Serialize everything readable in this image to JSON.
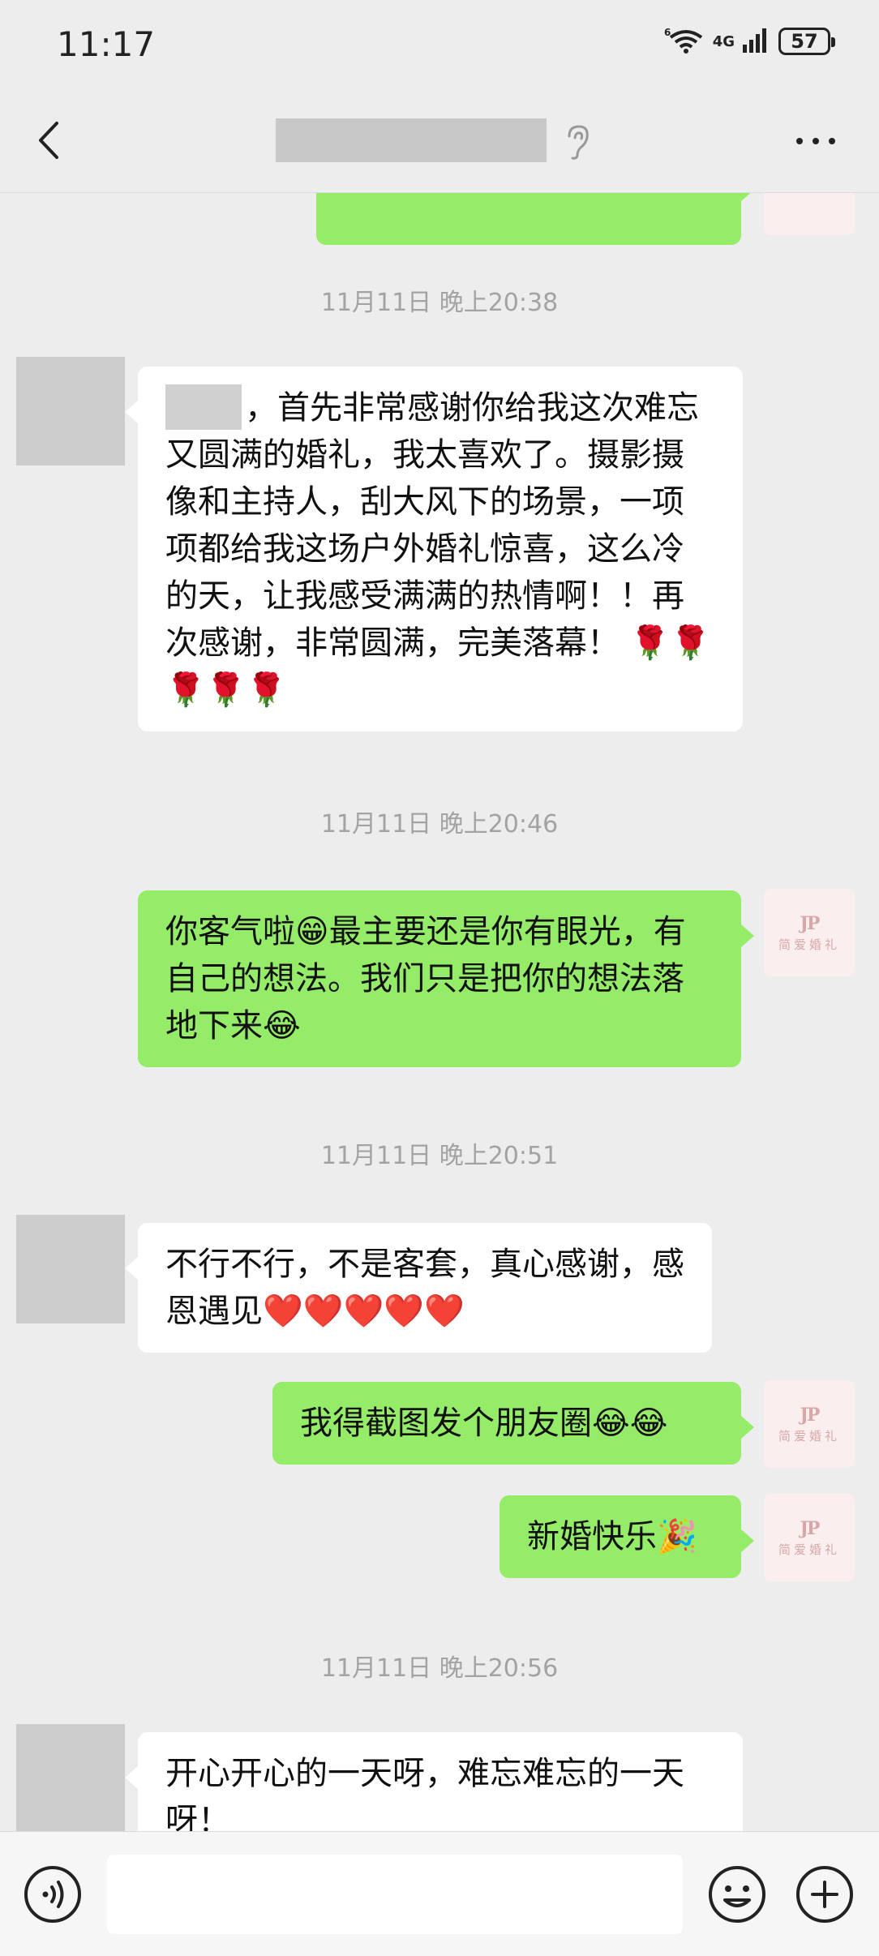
{
  "status_bar": {
    "time": "11:17",
    "wifi_badge": "6",
    "network": "4G",
    "battery": "57"
  },
  "header": {
    "contact_name": "",
    "icons": [
      "back-icon",
      "ear-icon",
      "more-icon"
    ]
  },
  "messages": [
    {
      "type": "timestamp",
      "text": "11月11日 晚上20:38"
    },
    {
      "type": "incoming",
      "text": "，首先非常感谢你给我这次难忘又圆满的婚礼，我太喜欢了。摄影摄像和主持人，刮大风下的场景，一项项都给我这场户外婚礼惊喜，这么冷的天，让我感受满满的热情啊！！再次感谢，非常圆满，完美落幕！ 🌹🌹🌹🌹🌹"
    },
    {
      "type": "timestamp",
      "text": "11月11日 晚上20:46"
    },
    {
      "type": "outgoing",
      "text": "你客气啦😁最主要还是你有眼光，有自己的想法。我们只是把你的想法落地下来😂"
    },
    {
      "type": "timestamp",
      "text": "11月11日 晚上20:51"
    },
    {
      "type": "incoming",
      "text": "不行不行，不是客套，真心感谢，感恩遇见❤️❤️❤️❤️❤️"
    },
    {
      "type": "outgoing",
      "text": "我得截图发个朋友圈😂😂"
    },
    {
      "type": "outgoing",
      "text": "新婚快乐🎉"
    },
    {
      "type": "timestamp",
      "text": "11月11日 晚上20:56"
    },
    {
      "type": "incoming",
      "text": "开心开心的一天呀，难忘难忘的一天呀！"
    }
  ],
  "my_avatar": {
    "mark": "JP",
    "caption": "简爱婚礼"
  },
  "input_bar": {
    "placeholder": "",
    "value": ""
  }
}
